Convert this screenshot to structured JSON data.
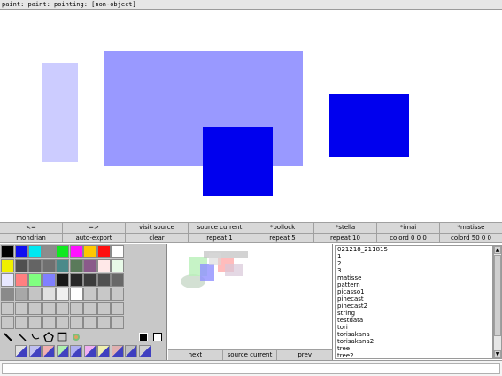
{
  "status_title": "paint: paint: pointing: [non-object]",
  "canvas_shapes": [
    {
      "name": "pale-blue-rectangle",
      "color": "#ccccff"
    },
    {
      "name": "light-blue-rectangle",
      "color": "#9999ff"
    },
    {
      "name": "blue-rectangle-bottom",
      "color": "#0000ee"
    },
    {
      "name": "blue-rectangle-right",
      "color": "#0000ee"
    }
  ],
  "toolbar_row1": [
    "<=",
    "=>",
    "visit source",
    "source current",
    "*pollock",
    "*stella",
    "*imai",
    "*matisse"
  ],
  "toolbar_row2": [
    "mondrian",
    "auto-export",
    "clear",
    "repeat 1",
    "repeat 5",
    "repeat 10",
    "colord 0 0 0",
    "colord 50 0 0"
  ],
  "palette": {
    "colors": [
      [
        "#000000",
        "#1010f0",
        "#00e8f0",
        "#8c8c8c",
        "#10e820",
        "#ff10ff",
        "#ffc800",
        "#ff1010",
        "#ffffff"
      ],
      [
        "#f0f000",
        "#505050",
        "#646464",
        "#707070",
        "#4a8a8a",
        "#5a7a5a",
        "#8a5a8a",
        "#ffe8e8",
        "#e8fae8"
      ],
      [
        "#e8e8ff",
        "#ff8080",
        "#80ff80",
        "#8080ff",
        "#181818",
        "#282828",
        "#3c3c3c",
        "#505050",
        "#686868"
      ],
      [
        "#8a8a8a",
        "#a8a8a8",
        "#c4c4c4",
        "#e0e0e0",
        "#f0f0f0",
        "#ffffff",
        "#c8c8c8",
        "#c8c8c8",
        "#c8c8c8"
      ]
    ],
    "tools": [
      "brush-icon",
      "line-icon",
      "curve-icon",
      "lasso-icon",
      "rectangle-icon",
      "image-icon",
      "filled-square-icon",
      "empty-square-icon"
    ]
  },
  "preview_buttons": [
    "next",
    "source current",
    "prev"
  ],
  "file_list": [
    "021218_211815",
    "1",
    "2",
    "3",
    "matisse",
    "pattern",
    "picasso1",
    "pinecast",
    "pinecast2",
    "string",
    "testdata",
    "tori",
    "torisakana",
    "torisakana2",
    "tree",
    "tree2"
  ]
}
